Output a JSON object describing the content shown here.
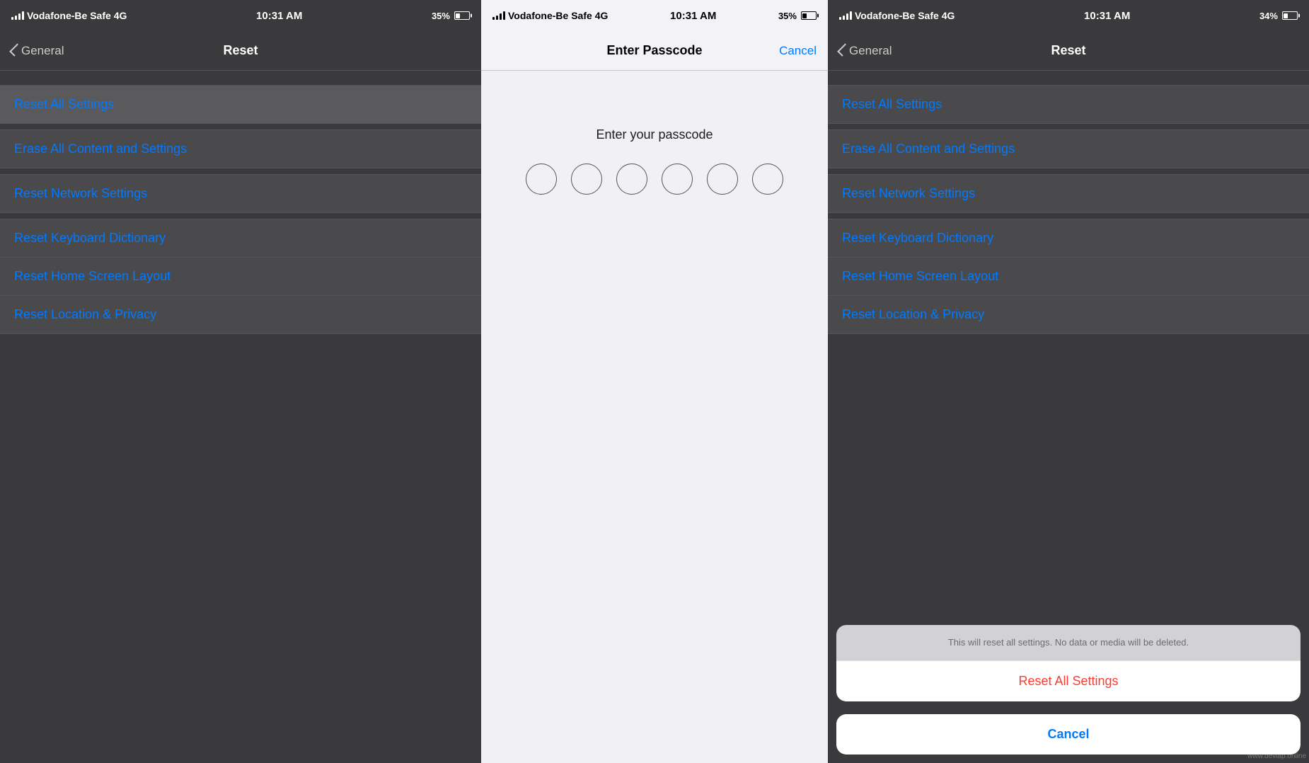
{
  "panel1": {
    "status": {
      "carrier": "Vodafone-Be Safe",
      "network": "4G",
      "time": "10:31 AM",
      "battery": "35%"
    },
    "nav": {
      "back_label": "General",
      "title": "Reset"
    },
    "items": [
      {
        "label": "Reset All Settings",
        "highlighted": true
      },
      {
        "label": "Erase All Content and Settings"
      },
      {
        "label": "Reset Network Settings"
      },
      {
        "label": "Reset Keyboard Dictionary"
      },
      {
        "label": "Reset Home Screen Layout"
      },
      {
        "label": "Reset Location & Privacy"
      }
    ]
  },
  "panel2": {
    "status": {
      "carrier": "Vodafone-Be Safe",
      "network": "4G",
      "time": "10:31 AM",
      "battery": "35%"
    },
    "nav": {
      "title": "Enter Passcode",
      "cancel_label": "Cancel"
    },
    "prompt": "Enter your passcode",
    "dots_count": 6
  },
  "panel3": {
    "status": {
      "carrier": "Vodafone-Be Safe",
      "network": "4G",
      "time": "10:31 AM",
      "battery": "34%"
    },
    "nav": {
      "back_label": "General",
      "title": "Reset"
    },
    "items": [
      {
        "label": "Reset All Settings"
      },
      {
        "label": "Erase All Content and Settings"
      },
      {
        "label": "Reset Network Settings"
      },
      {
        "label": "Reset Keyboard Dictionary"
      },
      {
        "label": "Reset Home Screen Layout"
      },
      {
        "label": "Reset Location & Privacy"
      }
    ],
    "action_sheet": {
      "message": "This will reset all settings. No data or media will be deleted.",
      "confirm_label": "Reset All Settings",
      "cancel_label": "Cancel"
    }
  }
}
